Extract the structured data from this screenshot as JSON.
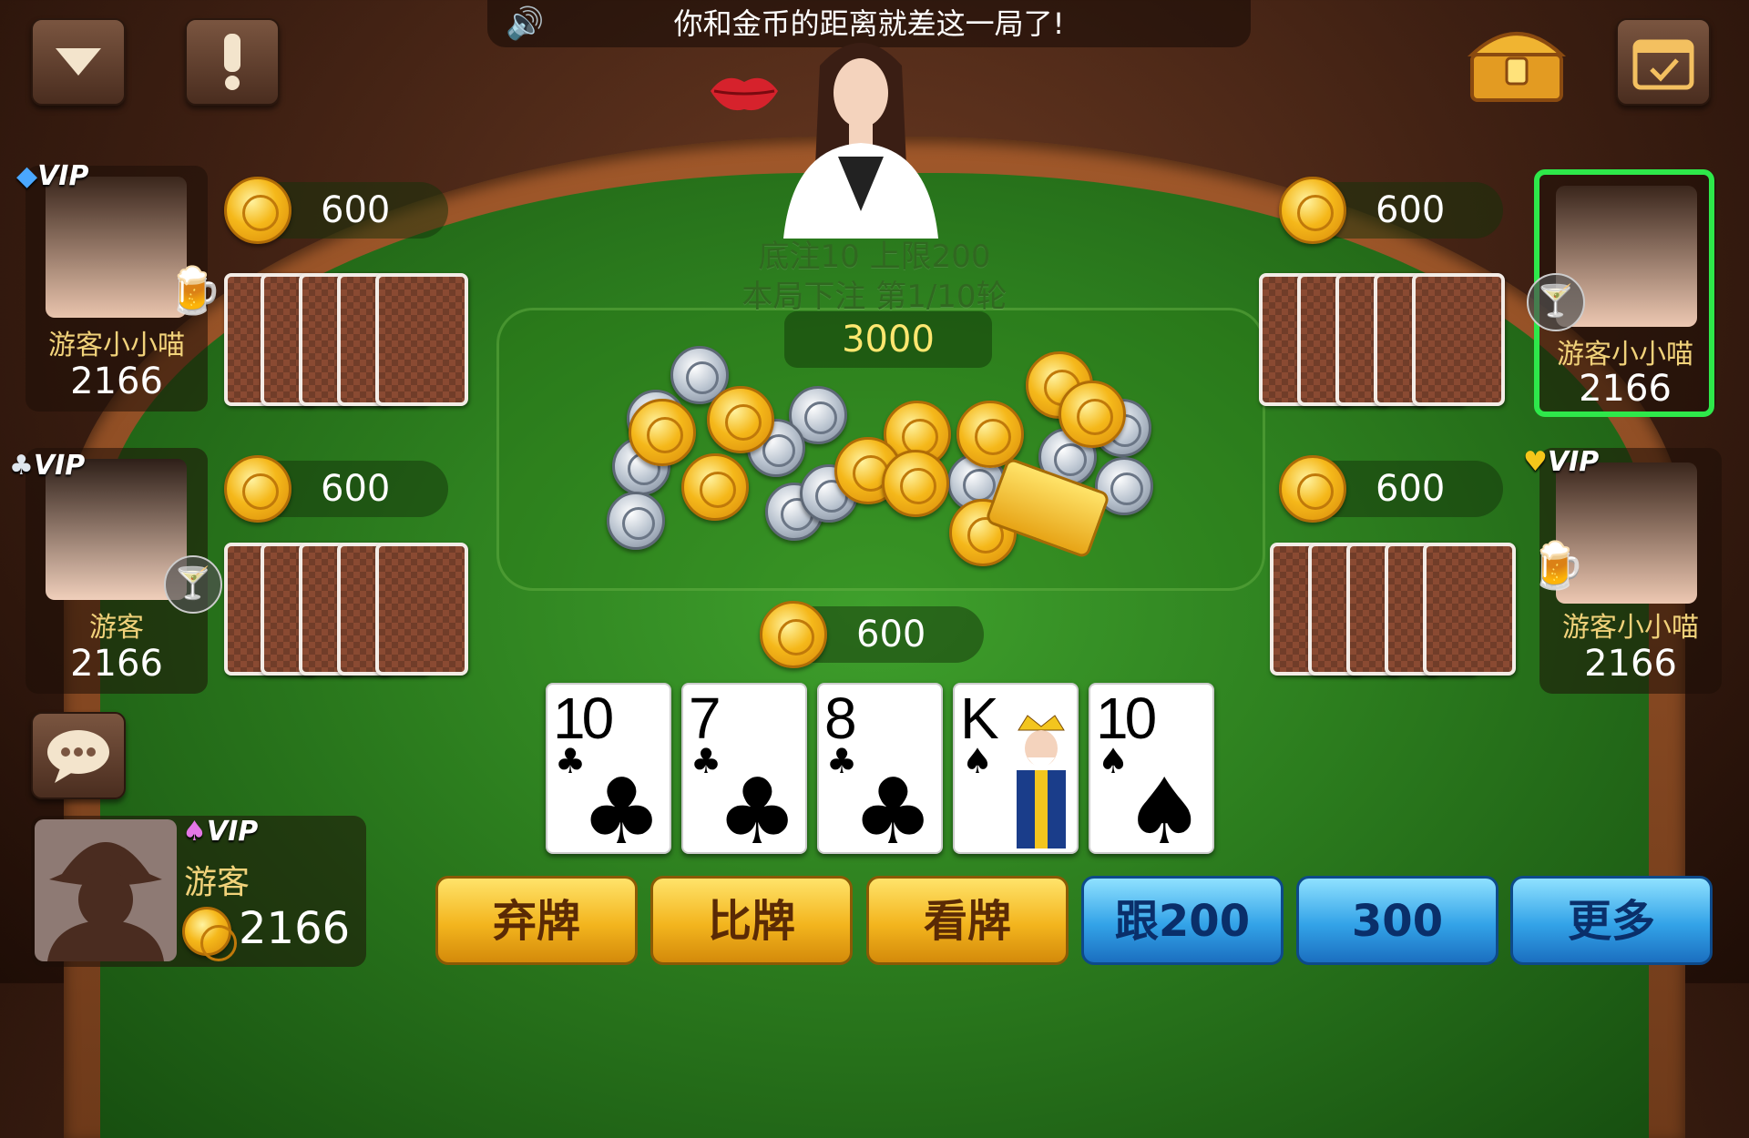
{
  "notice": {
    "text": "你和金币的距离就差这一局了!"
  },
  "table_info": {
    "line1": "底注10 上限200",
    "line2": "本局下注 第1/10轮",
    "pot": "3000"
  },
  "players": {
    "top_left": {
      "name": "游客小小喵",
      "coins": "2166",
      "bet": "600",
      "vip": "VIP"
    },
    "mid_left": {
      "name": "游客",
      "coins": "2166",
      "bet": "600",
      "vip": "VIP"
    },
    "top_right": {
      "name": "游客小小喵",
      "coins": "2166",
      "bet": "600"
    },
    "mid_right": {
      "name": "游客小小喵",
      "coins": "2166",
      "bet": "600",
      "vip": "VIP"
    },
    "self": {
      "name": "游客",
      "coins": "2166",
      "bet": "600",
      "vip": "VIP"
    }
  },
  "my_cards": [
    {
      "rank": "10",
      "suit": "♣"
    },
    {
      "rank": "7",
      "suit": "♣"
    },
    {
      "rank": "8",
      "suit": "♣"
    },
    {
      "rank": "K",
      "suit": "♠"
    },
    {
      "rank": "10",
      "suit": "♠"
    }
  ],
  "actions": {
    "fold": "弃牌",
    "compare": "比牌",
    "look": "看牌",
    "call": "跟200",
    "raise": "300",
    "more": "更多"
  },
  "icons": [
    "dropdown-icon",
    "alert-icon",
    "treasure-chest-icon",
    "calendar-check-icon",
    "speaker-icon",
    "chat-icon",
    "beer-icon",
    "cocktail-icon",
    "lips-icon"
  ],
  "colors": {
    "felt": "#2c7d1e",
    "active_highlight": "#2ee84a",
    "gold_button": "#f3b51e",
    "blue_button": "#33a3e8"
  }
}
